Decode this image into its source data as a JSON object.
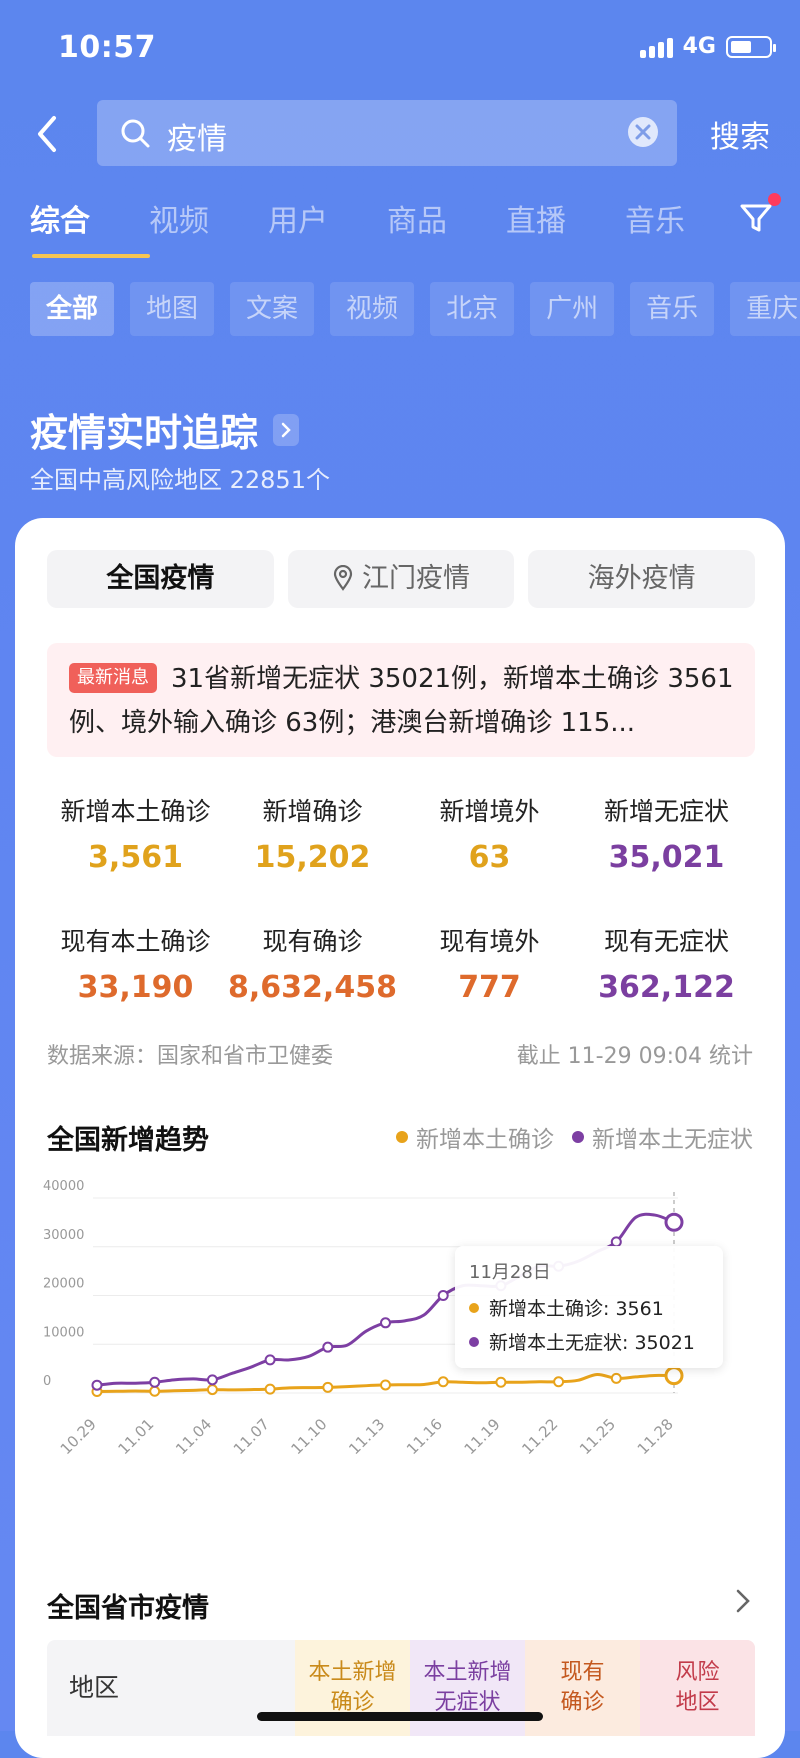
{
  "status": {
    "time": "10:57",
    "network": "4G"
  },
  "search": {
    "query": "疫情",
    "submit_label": "搜索"
  },
  "tabs": [
    {
      "label": "综合",
      "active": true
    },
    {
      "label": "视频"
    },
    {
      "label": "用户"
    },
    {
      "label": "商品"
    },
    {
      "label": "直播"
    },
    {
      "label": "音乐"
    }
  ],
  "chips": [
    "全部",
    "地图",
    "文案",
    "视频",
    "北京",
    "广州",
    "音乐",
    "重庆"
  ],
  "tracker": {
    "title": "疫情实时追踪",
    "subtitle": "全国中高风险地区 22851个"
  },
  "scope_tabs": [
    "全国疫情",
    "江门疫情",
    "海外疫情"
  ],
  "news": {
    "badge": "最新消息",
    "text": "31省新增无症状 35021例，新增本土确诊 3561例、境外输入确诊 63例；港澳台新增确诊 115..."
  },
  "stats": [
    {
      "label": "新增本土确诊",
      "value": "3,561",
      "color": "#e0a21c"
    },
    {
      "label": "新增确诊",
      "value": "15,202",
      "color": "#e0a21c"
    },
    {
      "label": "新增境外",
      "value": "63",
      "color": "#e0a21c"
    },
    {
      "label": "新增无症状",
      "value": "35,021",
      "color": "#7b3fa0"
    },
    {
      "label": "现有本土确诊",
      "value": "33,190",
      "color": "#de6a2c"
    },
    {
      "label": "现有确诊",
      "value": "8,632,458",
      "color": "#de6a2c"
    },
    {
      "label": "现有境外",
      "value": "777",
      "color": "#de6a2c"
    },
    {
      "label": "现有无症状",
      "value": "362,122",
      "color": "#7b3fa0"
    }
  ],
  "source": "数据来源：国家和省市卫健委",
  "cutoff": "截止 11-29 09:04 统计",
  "trend": {
    "title": "全国新增趋势"
  },
  "chart_data": {
    "type": "line",
    "x": [
      "10.29",
      "10.30",
      "10.31",
      "11.01",
      "11.02",
      "11.03",
      "11.04",
      "11.05",
      "11.06",
      "11.07",
      "11.08",
      "11.09",
      "11.10",
      "11.11",
      "11.12",
      "11.13",
      "11.14",
      "11.15",
      "11.16",
      "11.17",
      "11.18",
      "11.19",
      "11.20",
      "11.21",
      "11.22",
      "11.23",
      "11.24",
      "11.25",
      "11.26",
      "11.27",
      "11.28"
    ],
    "tick_labels": [
      "10.29",
      "11.01",
      "11.04",
      "11.07",
      "11.10",
      "11.13",
      "11.16",
      "11.19",
      "11.22",
      "11.25",
      "11.28"
    ],
    "series": [
      {
        "name": "新增本土确诊",
        "color": "#e8a31b",
        "values": [
          300,
          350,
          400,
          350,
          450,
          550,
          700,
          650,
          700,
          800,
          1050,
          1100,
          1150,
          1300,
          1500,
          1650,
          1700,
          1750,
          2300,
          2200,
          2100,
          2200,
          2200,
          2300,
          2300,
          2600,
          3800,
          3000,
          3300,
          3600,
          3561
        ]
      },
      {
        "name": "新增本土无症状",
        "color": "#7d3fa3",
        "values": [
          1600,
          2000,
          2000,
          2200,
          2700,
          2900,
          2700,
          4000,
          5300,
          6800,
          6800,
          7500,
          9400,
          9800,
          12700,
          14400,
          14800,
          16000,
          20000,
          22000,
          22000,
          22000,
          24000,
          26000,
          26000,
          27000,
          29000,
          31000,
          36000,
          36500,
          35021
        ]
      }
    ],
    "yticks": [
      0,
      10000,
      20000,
      30000,
      40000
    ],
    "ylim": [
      0,
      40000
    ],
    "grid": true,
    "legend": "top-right",
    "tooltip": {
      "date": "11月28日",
      "lines": [
        "新增本土确诊: 3561",
        "新增本土无症状: 35021"
      ]
    }
  },
  "province": {
    "title": "全国省市疫情",
    "headers": [
      {
        "label": "地区"
      },
      {
        "label": "本土新增\n确诊",
        "color": "#c98a1a",
        "bg": "#fdf3dc"
      },
      {
        "label": "本土新增\n无症状",
        "color": "#7b3fa0",
        "bg": "#f1e7f7"
      },
      {
        "label": "现有\n确诊",
        "color": "#c4581f",
        "bg": "#fcebdf"
      },
      {
        "label": "风险\n地区",
        "color": "#c23b4a",
        "bg": "#fbe3e6"
      }
    ]
  }
}
